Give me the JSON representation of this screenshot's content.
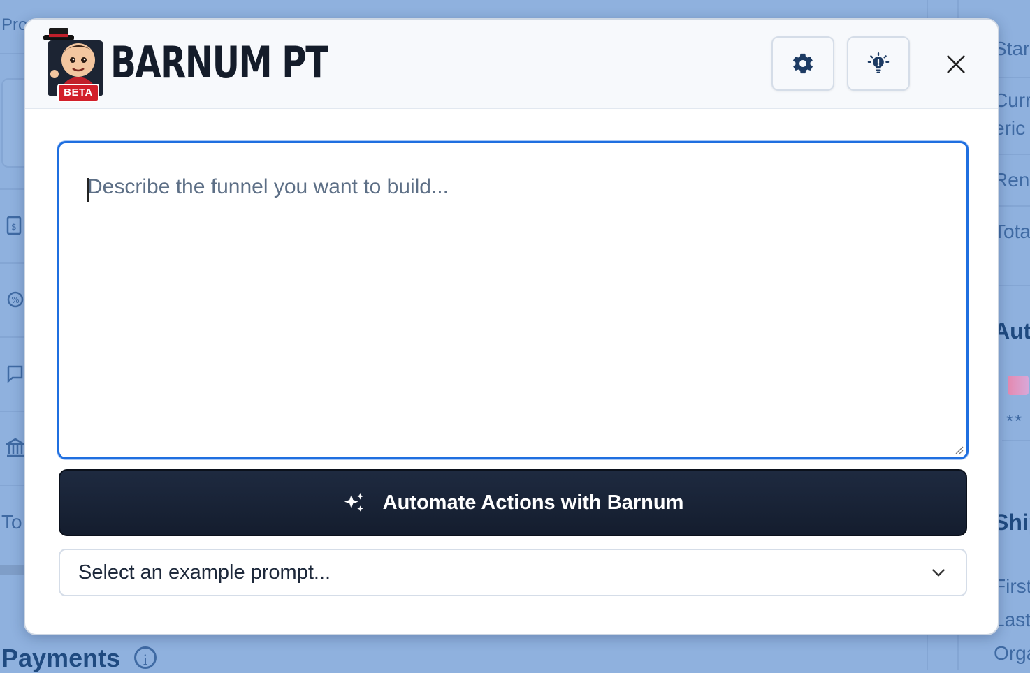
{
  "background": {
    "left_texts": [
      "Pro",
      "To"
    ],
    "section_title": "Payments",
    "right_texts": [
      "Star",
      "Curr",
      "eric",
      "Rene",
      "Tota",
      "Aut",
      "Ship",
      "First",
      "Last",
      "Orga"
    ],
    "masked_card": "**"
  },
  "header": {
    "badge": "BETA",
    "title": "BARNUM PT",
    "settings_icon": "gear-icon",
    "tips_icon": "lightbulb-icon",
    "close_icon": "close-icon"
  },
  "prompt": {
    "placeholder": "Describe the funnel you want to build...",
    "value": ""
  },
  "automate_button": {
    "icon": "sparkles-icon",
    "label": "Automate Actions with Barnum"
  },
  "example_select": {
    "selected": "Select an example prompt...",
    "icon": "chevron-down-icon"
  },
  "colors": {
    "accent": "#1f6fe0",
    "button_dark": "#141d2e",
    "beta_red": "#d21f2a",
    "overlay_blue": "#8fb1de"
  }
}
